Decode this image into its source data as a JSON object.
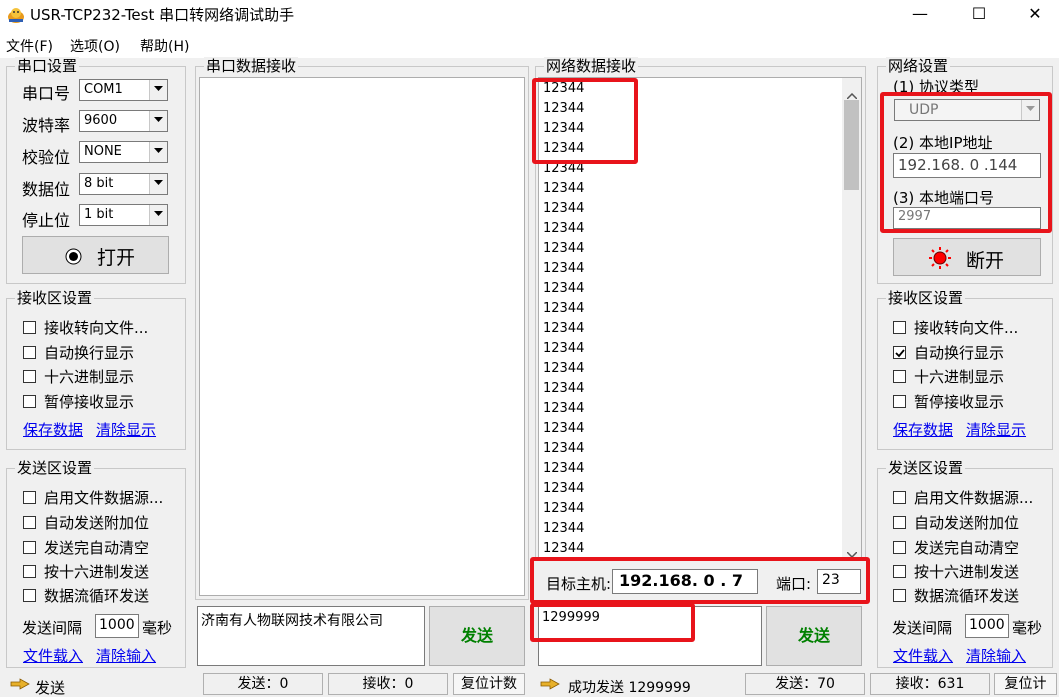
{
  "window": {
    "title": "USR-TCP232-Test 串口转网络调试助手",
    "controls": {
      "minimize": "—",
      "maximize": "☐",
      "close": "✕"
    }
  },
  "menu": [
    "文件(F)",
    "选项(O)",
    "帮助(H)"
  ],
  "serial_settings": {
    "title": "串口设置",
    "port_label": "串口号",
    "port_value": "COM1",
    "baud_label": "波特率",
    "baud_value": "9600",
    "parity_label": "校验位",
    "parity_value": "NONE",
    "data_bits_label": "数据位",
    "data_bits_value": "8 bit",
    "stop_bits_label": "停止位",
    "stop_bits_value": "1 bit",
    "open_button": "打开"
  },
  "left_receive_settings": {
    "title": "接收区设置",
    "options": [
      {
        "label": "接收转向文件...",
        "checked": false
      },
      {
        "label": "自动换行显示",
        "checked": false
      },
      {
        "label": "十六进制显示",
        "checked": false
      },
      {
        "label": "暂停接收显示",
        "checked": false
      }
    ],
    "save_link": "保存数据",
    "clear_link": "清除显示"
  },
  "left_send_settings": {
    "title": "发送区设置",
    "options": [
      {
        "label": "启用文件数据源...",
        "checked": false
      },
      {
        "label": "自动发送附加位",
        "checked": false
      },
      {
        "label": "发送完自动清空",
        "checked": false
      },
      {
        "label": "按十六进制发送",
        "checked": false
      },
      {
        "label": "数据流循环发送",
        "checked": false
      }
    ],
    "interval_label": "发送间隔",
    "interval_value": "1000",
    "interval_unit": "毫秒",
    "load_file_link": "文件载入",
    "clear_input_link": "清除输入"
  },
  "serial_receive": {
    "title": "串口数据接收"
  },
  "serial_send": {
    "text": "济南有人物联网技术有限公司",
    "send_button": "发送"
  },
  "network_receive": {
    "title": "网络数据接收",
    "lines": [
      "12344",
      "12344",
      "12344",
      "12344",
      "12344",
      "12344",
      "12344",
      "12344",
      "12344",
      "12344",
      "12344",
      "12344",
      "12344",
      "12344",
      "12344",
      "12344",
      "12344",
      "12344",
      "12344",
      "12344",
      "12344",
      "12344",
      "12344",
      "12344"
    ]
  },
  "target": {
    "host_label": "目标主机:",
    "host_ip": "192.168. 0 . 7",
    "port_label": "端口:",
    "port_value": "23"
  },
  "network_send": {
    "text": "1299999",
    "send_button": "发送"
  },
  "network_settings": {
    "title": "网络设置",
    "protocol_label": "(1) 协议类型",
    "protocol_value": "UDP",
    "ip_label": "(2) 本地IP地址",
    "ip_value": "192.168. 0 .144",
    "port_label": "(3) 本地端口号",
    "port_value": "2997",
    "disconnect_button": "断开"
  },
  "right_receive_settings": {
    "title": "接收区设置",
    "options": [
      {
        "label": "接收转向文件...",
        "checked": false
      },
      {
        "label": "自动换行显示",
        "checked": true
      },
      {
        "label": "十六进制显示",
        "checked": false
      },
      {
        "label": "暂停接收显示",
        "checked": false
      }
    ],
    "save_link": "保存数据",
    "clear_link": "清除显示"
  },
  "right_send_settings": {
    "title": "发送区设置",
    "options": [
      {
        "label": "启用文件数据源...",
        "checked": false
      },
      {
        "label": "自动发送附加位",
        "checked": false
      },
      {
        "label": "发送完自动清空",
        "checked": false
      },
      {
        "label": "按十六进制发送",
        "checked": false
      },
      {
        "label": "数据流循环发送",
        "checked": false
      }
    ],
    "interval_label": "发送间隔",
    "interval_value": "1000",
    "interval_unit": "毫秒",
    "load_file_link": "文件载入",
    "clear_input_link": "清除输入"
  },
  "status_bar": {
    "left_status": "发送",
    "serial_sent": "发送：0",
    "serial_received": "接收：0",
    "serial_reset": "复位计数",
    "network_status": "成功发送 1299999",
    "network_sent": "发送：70",
    "network_received": "接收：631",
    "network_reset": "复位计"
  },
  "colors": {
    "highlight": "#e8141b",
    "send_button_text": "#008000",
    "link": "#0000ee",
    "indicator_red": "#ff0000"
  }
}
